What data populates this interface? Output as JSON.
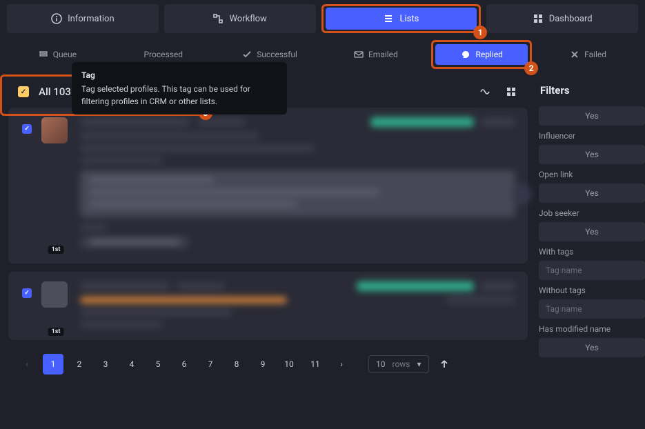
{
  "tabs": {
    "information": "Information",
    "workflow": "Workflow",
    "lists": "Lists",
    "dashboard": "Dashboard"
  },
  "subtabs": {
    "queue": "Queue",
    "processed": "Processed",
    "successful": "Successful",
    "emailed": "Emailed",
    "replied": "Replied",
    "failed": "Failed"
  },
  "tooltip": {
    "title": "Tag",
    "body": "Tag selected profiles. This tag can be used for filtering profiles in CRM or other lists."
  },
  "selectRow": {
    "all_label": "All 103 / 103"
  },
  "cards": {
    "first_degree": "1st",
    "second_degree": "1st"
  },
  "pagination": {
    "pages": [
      "1",
      "2",
      "3",
      "4",
      "5",
      "6",
      "7",
      "8",
      "9",
      "10",
      "11"
    ],
    "rows_num": "10",
    "rows_label": "rows"
  },
  "filters": {
    "title": "Filters",
    "yes": "Yes",
    "influencer": "Influencer",
    "open_link": "Open link",
    "job_seeker": "Job seeker",
    "with_tags": "With tags",
    "without_tags": "Without tags",
    "tag_placeholder": "Tag name",
    "has_modified_name": "Has modified name"
  },
  "badges": {
    "b1": "1",
    "b2": "2",
    "b3": "3"
  }
}
